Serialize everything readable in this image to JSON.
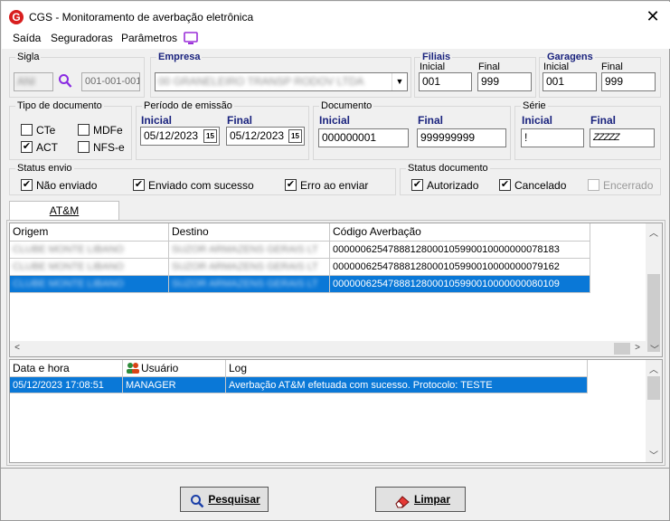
{
  "window": {
    "title": "CGS - Monitoramento de averbação eletrônica",
    "close_glyph": "✕",
    "logo_glyph": "G"
  },
  "menu": {
    "items": [
      "Saída",
      "Seguradoras",
      "Parâmetros"
    ]
  },
  "sigla": {
    "legend": "Sigla",
    "code_value": "ANI",
    "range_value": "001-001-001"
  },
  "empresa": {
    "legend": "Empresa",
    "value": "00 GRANELEIRO TRANSP RODOV LTDA"
  },
  "filiais": {
    "legend": "Filiais",
    "inicial_label": "Inicial",
    "final_label": "Final",
    "inicial": "001",
    "final": "999"
  },
  "garagens": {
    "legend": "Garagens",
    "inicial_label": "Inicial",
    "final_label": "Final",
    "inicial": "001",
    "final": "999"
  },
  "tipo_documento": {
    "legend": "Tipo de documento",
    "cte": "CTe",
    "mdfe": "MDFe",
    "act": "ACT",
    "nfse": "NFS-e",
    "cte_checked": false,
    "mdfe_checked": false,
    "act_checked": true,
    "nfse_checked": false
  },
  "periodo": {
    "legend": "Período de emissão",
    "inicial_label": "Inicial",
    "final_label": "Final",
    "inicial": "05/12/2023",
    "final": "05/12/2023",
    "cal_glyph": "15"
  },
  "documento": {
    "legend": "Documento",
    "inicial_label": "Inicial",
    "final_label": "Final",
    "inicial": "000000001",
    "final": "999999999"
  },
  "serie": {
    "legend": "Série",
    "inicial_label": "Inicial",
    "final_label": "Final",
    "inicial": "!",
    "final": "ZZZZZ"
  },
  "status_envio": {
    "legend": "Status envio",
    "nao_enviado": "Não enviado",
    "enviado": "Enviado com sucesso",
    "erro": "Erro ao enviar"
  },
  "status_documento": {
    "legend": "Status documento",
    "autorizado": "Autorizado",
    "cancelado": "Cancelado",
    "encerrado": "Encerrado"
  },
  "tab": {
    "label": "AT&M"
  },
  "main_grid": {
    "columns": [
      "Origem",
      "Destino",
      "Código Averbação"
    ],
    "rows": [
      {
        "origem": "CLUBE MONTE LIBANO",
        "destino": "SUZOR ARMAZENS GERAIS LT",
        "codigo": "00000062547888128000105990010000000078183"
      },
      {
        "origem": "CLUBE MONTE LIBANO",
        "destino": "SUZOR ARMAZENS GERAIS LT",
        "codigo": "00000062547888128000105990010000000079162"
      },
      {
        "origem": "CLUBE MONTE LIBANO",
        "destino": "SUZOR ARMAZENS GERAIS LT",
        "codigo": "00000062547888128000105990010000000080109"
      }
    ]
  },
  "log_grid": {
    "columns": [
      "Data e hora",
      "Usuário",
      "Log"
    ],
    "rows": [
      {
        "data": "05/12/2023 17:08:51",
        "usuario": "MANAGER",
        "log": "Averbação AT&M efetuada com sucesso. Protocolo: TESTE"
      }
    ]
  },
  "buttons": {
    "pesquisar": "Pesquisar",
    "limpar": "Limpar"
  },
  "icons": {
    "search": "search-icon",
    "monitor": "monitor-icon",
    "calendar": "calendar-icon",
    "dropdown": "chevron-down-icon",
    "users": "users-icon",
    "eraser": "eraser-icon"
  },
  "colors": {
    "accent": "#0a78d7",
    "label_blue": "#1a237e",
    "logo_red": "#d81e1e",
    "search_purple": "#8a2be2"
  }
}
